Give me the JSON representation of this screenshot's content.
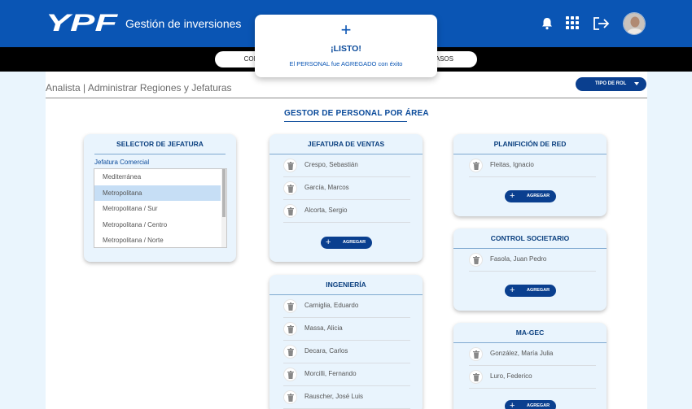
{
  "header": {
    "logo_text": "YPF",
    "app_title": "Gestión de inversiones",
    "icons": [
      "bell-icon",
      "apps-grid-icon",
      "logout-icon"
    ]
  },
  "tabs": {
    "left_label": "COM",
    "right_label": "CASOS"
  },
  "breadcrumb": "Analista | Administrar Regiones y Jefaturas",
  "role_button": "TIPO DE ROL",
  "section_title": "GESTOR DE PERSONAL POR ÁREA",
  "selector": {
    "title": "SELECTOR DE JEFATURA",
    "label": "Jefatura Comercial",
    "options": [
      "Mediterránea",
      "Metropolitana",
      "Metropolitana / Sur",
      "Metropolitana / Centro",
      "Metropolitana / Norte"
    ],
    "selected": "Metropolitana"
  },
  "cards": {
    "ventas": {
      "title": "JEFATURA DE VENTAS",
      "people": [
        "Crespo, Sebastián",
        "García, Marcos",
        "Alcorta, Sergio"
      ],
      "add_label": "AGREGAR"
    },
    "ingenieria": {
      "title": "INGENIERÍA",
      "people": [
        "Carniglia, Eduardo",
        "Massa, Alicia",
        "Decara, Carlos",
        "Morcilli, Fernando",
        "Rauscher, José Luis"
      ]
    },
    "red": {
      "title": "PLANIFICIÓN DE RED",
      "people": [
        "Fleitas, Ignacio"
      ],
      "add_label": "AGREGAR"
    },
    "societario": {
      "title": "CONTROL SOCIETARIO",
      "people": [
        "Fasola, Juan Pedro"
      ],
      "add_label": "AGREGAR"
    },
    "magec": {
      "title": "MA-GEC",
      "people": [
        "González, María Julia",
        "Luro, Federico"
      ],
      "add_label": "AGREGAR"
    }
  },
  "toast": {
    "icon": "plus-icon",
    "title": "¡LISTO!",
    "message": "El PERSONAL fue AGREGADO con éxito"
  },
  "colors": {
    "brand_blue": "#0a55b4",
    "button_navy": "#0a3f8f",
    "card_bg": "#e9f4fd"
  }
}
